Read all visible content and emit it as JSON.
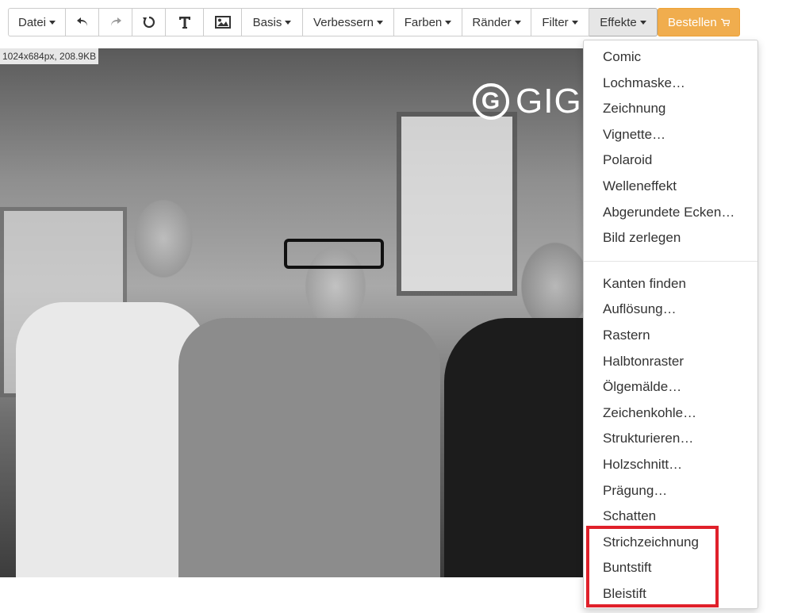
{
  "toolbar": {
    "file_label": "Datei",
    "basis_label": "Basis",
    "improve_label": "Verbessern",
    "colors_label": "Farben",
    "borders_label": "Ränder",
    "filter_label": "Filter",
    "effects_label": "Effekte",
    "order_label": "Bestellen"
  },
  "canvas": {
    "image_info": "1024x684px, 208.9KB",
    "logo_text": "GIG"
  },
  "effects_menu": {
    "group1": [
      "Comic",
      "Lochmaske…",
      "Zeichnung",
      "Vignette…",
      "Polaroid",
      "Welleneffekt",
      "Abgerundete Ecken…",
      "Bild zerlegen"
    ],
    "group2": [
      "Kanten finden",
      "Auflösung…",
      "Rastern",
      "Halbtonraster",
      "Ölgemälde…",
      "Zeichenkohle…",
      "Strukturieren…",
      "Holzschnitt…",
      "Prägung…",
      "Schatten",
      "Strichzeichnung",
      "Buntstift",
      "Bleistift"
    ]
  },
  "colors": {
    "order_button": "#f0ad4e",
    "highlight_box": "#e0202a"
  },
  "icons": {
    "undo": "undo-icon",
    "redo": "redo-icon",
    "rotate": "rotate-icon",
    "text": "text-icon",
    "image": "image-icon",
    "cart": "cart-icon"
  }
}
